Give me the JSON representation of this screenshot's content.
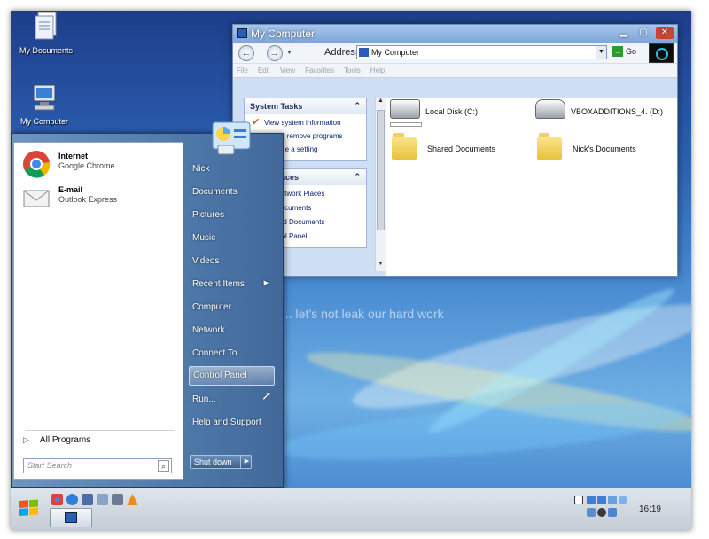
{
  "desktop": {
    "icons": [
      {
        "label": "My Documents"
      },
      {
        "label": "My Computer"
      }
    ],
    "slogan": "... let’s not leak our hard work",
    "tile_letters": "R L"
  },
  "window": {
    "title": "My Computer",
    "address_label": "Address",
    "address_value": "My Computer",
    "go_label": "Go",
    "menu": [
      "File",
      "Edit",
      "View",
      "Favorites",
      "Tools",
      "Help"
    ],
    "system_tasks": {
      "title": "System Tasks",
      "items": [
        "View system information",
        "Add or remove programs",
        "Change a setting"
      ]
    },
    "other_places": {
      "title": "Other Places",
      "items": [
        "My Network Places",
        "My Documents",
        "Shared Documents",
        "Control Panel"
      ]
    },
    "items": [
      {
        "label": "Local Disk (C:)",
        "icon": "hard-disk-icon"
      },
      {
        "label": "VBOXADDITIONS_4. (D:)",
        "icon": "cd-drive-icon"
      },
      {
        "label": "Shared Documents",
        "icon": "folder-icon"
      },
      {
        "label": "Nick's Documents",
        "icon": "folder-icon"
      }
    ]
  },
  "start_menu": {
    "pinned": [
      {
        "name": "Internet",
        "sub": "Google Chrome"
      },
      {
        "name": "E-mail",
        "sub": "Outlook Express"
      }
    ],
    "all_programs": "All Programs",
    "search_placeholder": "Start Search",
    "right": [
      "Nick",
      "Documents",
      "Pictures",
      "Music",
      "Videos",
      "Recent Items",
      "Computer",
      "Network",
      "Connect To",
      "Control Panel",
      "Run...",
      "Help and Support"
    ],
    "selected": "Control Panel",
    "shutdown": "Shut down"
  },
  "taskbar": {
    "clock": "16:19"
  },
  "colors": {
    "desktop": "#2d62b4",
    "accent": "#2b5cb8"
  }
}
